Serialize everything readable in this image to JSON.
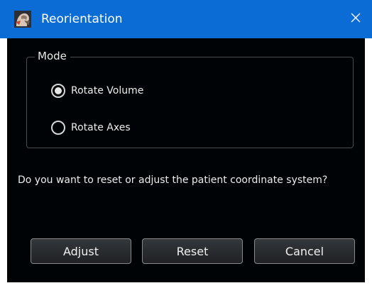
{
  "window": {
    "title": "Reorientation",
    "titlebar_color": "#0b6cd6",
    "background_color": "#000306",
    "app_icon": "patient-head-icon",
    "close_icon": "close-icon"
  },
  "mode_group": {
    "legend": "Mode",
    "options": [
      {
        "label": "Rotate Volume",
        "selected": true
      },
      {
        "label": "Rotate Axes",
        "selected": false
      }
    ]
  },
  "question": "Do you want to reset or adjust the patient coordinate system?",
  "buttons": {
    "adjust": "Adjust",
    "reset": "Reset",
    "cancel": "Cancel"
  }
}
